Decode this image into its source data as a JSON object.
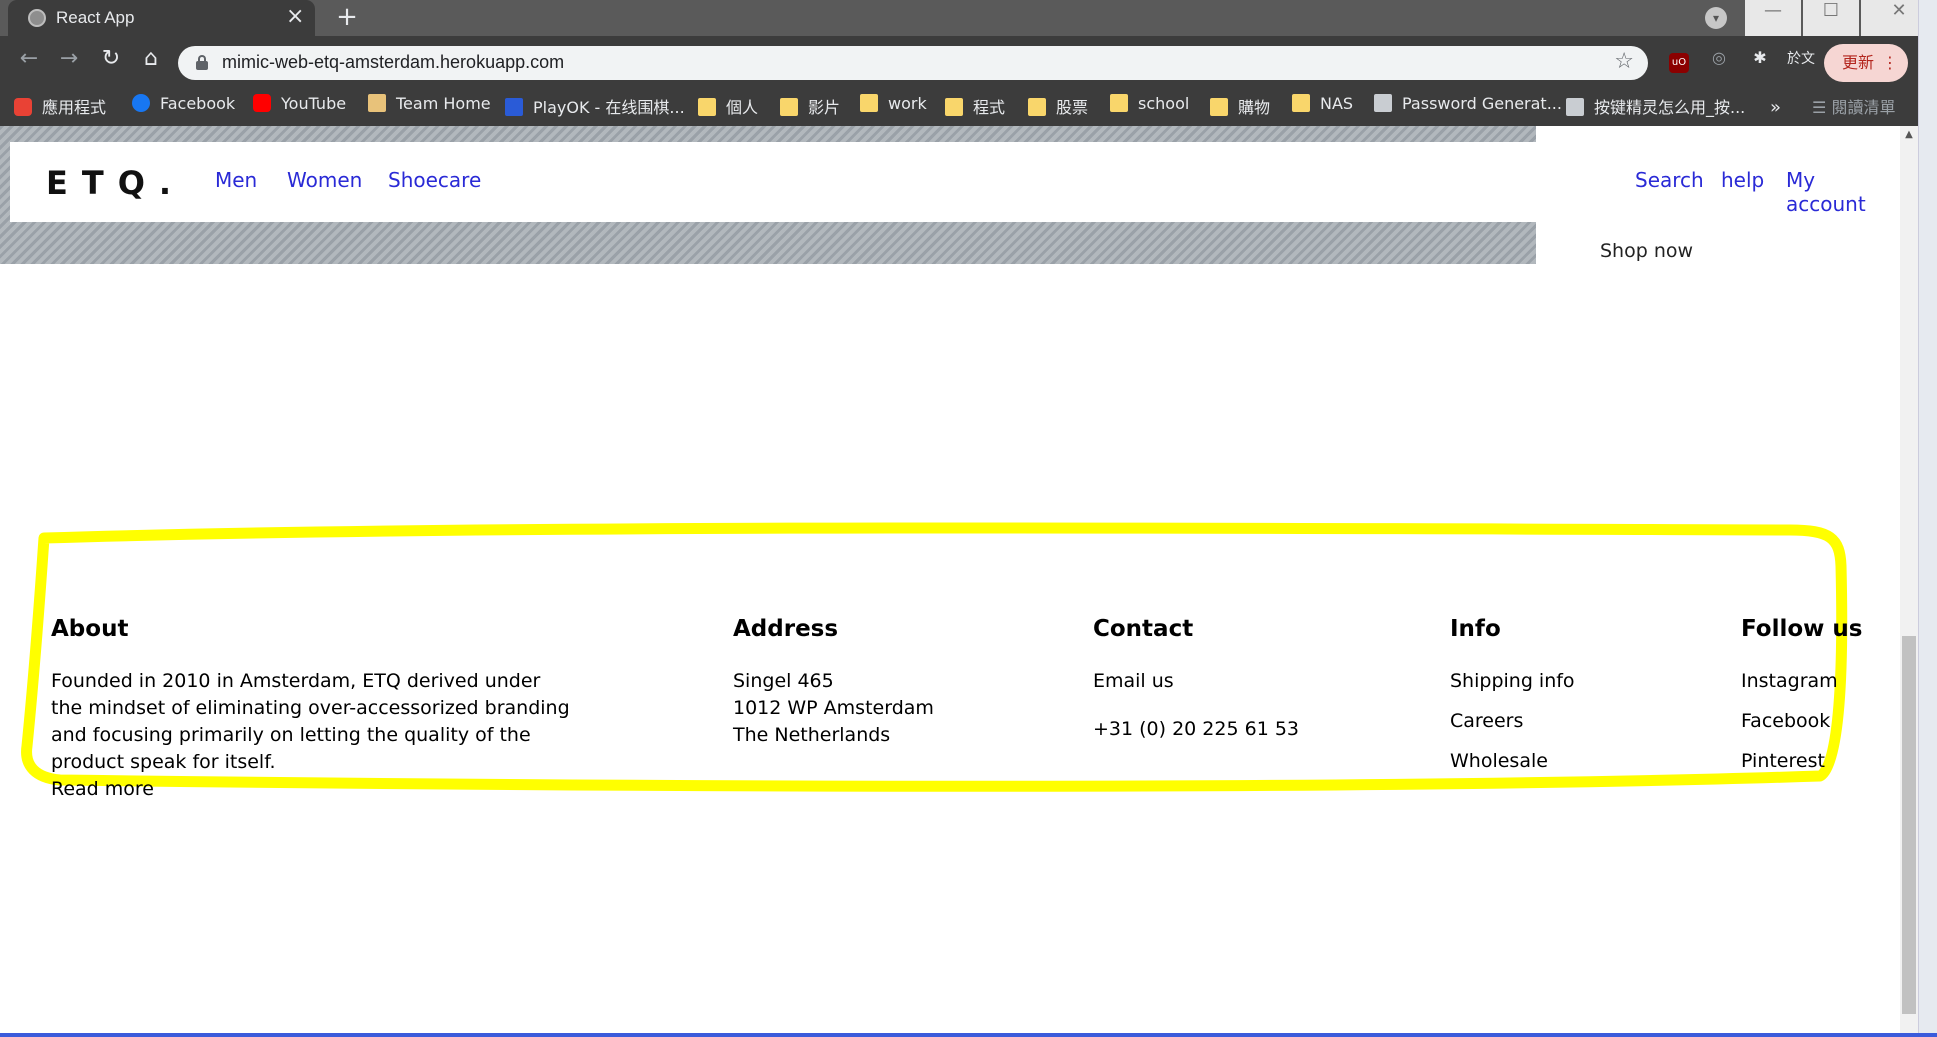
{
  "browser": {
    "tab_title": "React App",
    "url": "mimic-web-etq-amsterdam.herokuapp.com",
    "update_label": "更新",
    "translate_label": "於文",
    "bookmarks": [
      {
        "label": "應用程式",
        "icon": "apps-grid-icon"
      },
      {
        "label": "Facebook",
        "icon": "facebook-icon"
      },
      {
        "label": "YouTube",
        "icon": "youtube-icon"
      },
      {
        "label": "Team Home",
        "icon": "team-home-icon"
      },
      {
        "label": "PlayOK - 在线围棋...",
        "icon": "playok-icon"
      },
      {
        "label": "個人",
        "icon": "folder-icon"
      },
      {
        "label": "影片",
        "icon": "folder-icon"
      },
      {
        "label": "work",
        "icon": "folder-icon"
      },
      {
        "label": "程式",
        "icon": "folder-icon"
      },
      {
        "label": "股票",
        "icon": "folder-icon"
      },
      {
        "label": "school",
        "icon": "folder-icon"
      },
      {
        "label": "購物",
        "icon": "folder-icon"
      },
      {
        "label": "NAS",
        "icon": "folder-icon"
      },
      {
        "label": "Password Generat...",
        "icon": "page-icon"
      },
      {
        "label": "按键精灵怎么用_按...",
        "icon": "page-icon"
      }
    ],
    "reading_list_label": "閱讀清單"
  },
  "site": {
    "logo": "ETQ.",
    "nav": {
      "men": "Men",
      "women": "Women",
      "shoecare": "Shoecare"
    },
    "utility": {
      "search": "Search",
      "help": "help",
      "account": "My account"
    },
    "shop_now": "Shop now"
  },
  "footer": {
    "about": {
      "heading": "About",
      "text": "Founded in 2010 in Amsterdam, ETQ derived under the mindset of eliminating over-accessorized branding and focusing primarily on letting the quality of the product speak for itself.",
      "read_more": "Read more"
    },
    "address": {
      "heading": "Address",
      "line1": "Singel 465",
      "line2": "1012 WP Amsterdam",
      "line3": "The Netherlands"
    },
    "contact": {
      "heading": "Contact",
      "email": "Email us",
      "phone": "+31 (0) 20 225 61 53"
    },
    "info": {
      "heading": "Info",
      "links": [
        "Shipping info",
        "Careers",
        "Wholesale"
      ]
    },
    "follow": {
      "heading": "Follow us",
      "links": [
        "Instagram",
        "Facebook",
        "Pinterest"
      ]
    }
  },
  "colors": {
    "link_blue": "#2a2ad6",
    "highlight_yellow": "#ffff00"
  }
}
